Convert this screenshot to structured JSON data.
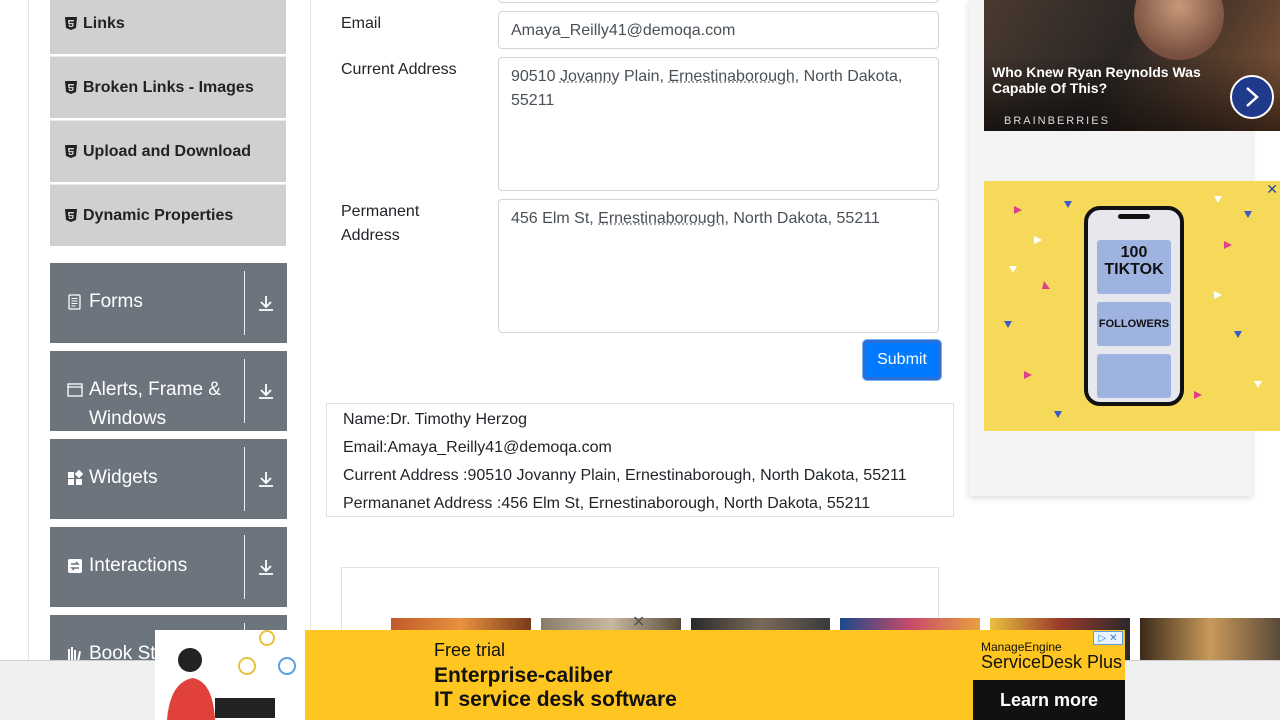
{
  "sidebar": {
    "elements_items": [
      {
        "label": "Links",
        "top": 0
      },
      {
        "label": "Broken Links - Images"
      },
      {
        "label": "Upload and Download"
      },
      {
        "label": "Dynamic Properties"
      }
    ],
    "groups": [
      {
        "label": "Forms",
        "icon": "form-icon"
      },
      {
        "label": "Alerts, Frame & Windows",
        "icon": "window-icon"
      },
      {
        "label": "Widgets",
        "icon": "widgets-icon"
      },
      {
        "label": "Interactions",
        "icon": "interactions-icon"
      },
      {
        "label": "Book Store Application",
        "icon": "book-store-icon"
      }
    ]
  },
  "form": {
    "email_label": "Email",
    "email_value": "Amaya_Reilly41@demoqa.com",
    "current_address_label": "Current Address",
    "current_address_value": [
      "90510 ",
      "Jovanny",
      " Plain, ",
      "Ernestinaborough",
      ", North Dakota, 55211"
    ],
    "permanent_address_label": "Permanent Address",
    "permanent_address_value": [
      "456 Elm St, ",
      "Ernestinaborough",
      ", North Dakota, 55211"
    ],
    "submit_label": "Submit"
  },
  "output": {
    "name": "Name:Dr. Timothy Herzog",
    "email": "Email:Amaya_Reilly41@demoqa.com",
    "current_address": "Current Address :90510 Jovanny Plain, Ernestinaborough, North Dakota, 55211",
    "permanent_address": "Permananet Address :456 Elm St, Ernestinaborough, North Dakota, 55211"
  },
  "ads": {
    "right_top": {
      "headline": "Who Knew Ryan Reynolds Was Capable Of This?",
      "brand": "BRAINBERRIES"
    },
    "right_middle": {
      "line1": "100",
      "line2": "TIKTOK",
      "line3": "FOLLOWERS"
    },
    "banner": {
      "trial": "Free trial",
      "headline_1": "Enterprise-caliber",
      "headline_2": "IT service desk software",
      "brand": "ManageEngine",
      "product": "ServiceDesk Plus",
      "cta": "Learn more"
    }
  },
  "colors": {
    "primary": "#007bff",
    "group_bg": "#6c757d",
    "sub_item_bg": "#d0d0d0",
    "banner_bg": "#ffc520"
  }
}
